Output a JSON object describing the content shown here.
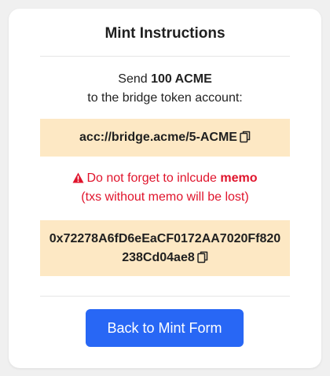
{
  "title": "Mint Instructions",
  "instruction": {
    "prefix": "Send ",
    "amount": "100 ACME",
    "line2": "to the bridge token account:"
  },
  "bridge_account": "acc://bridge.acme/5-ACME",
  "warning": {
    "prefix": "Do not forget to inlcude ",
    "emphasis": "memo",
    "line2": "(txs without memo will be lost)"
  },
  "memo_value": "0x72278A6fD6eEaCF0172AA7020Ff820238Cd04ae8",
  "button_label": "Back to Mint Form",
  "icons": {
    "copy": "copy-icon",
    "warning": "warning-triangle-icon"
  },
  "colors": {
    "accent": "#2867f5",
    "warning": "#e0142c",
    "highlight": "#fde8c4"
  }
}
